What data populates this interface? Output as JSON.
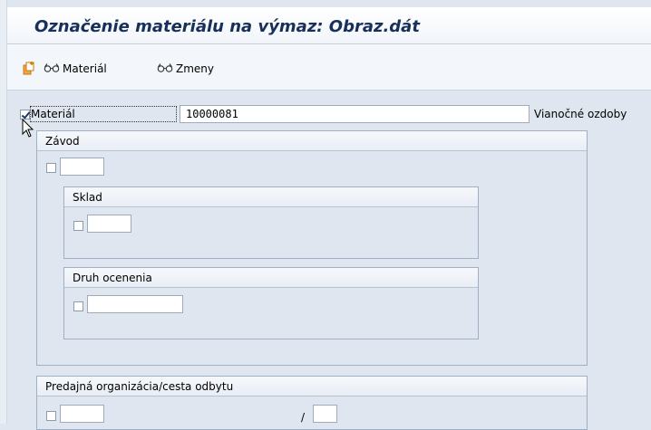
{
  "window": {
    "title": "Označenie materiálu na výmaz: Obraz.dát"
  },
  "toolbar": {
    "items": [
      {
        "icon": "new-document-icon",
        "label": ""
      },
      {
        "icon": "glasses-icon",
        "label": "Materiál"
      },
      {
        "icon": "glasses-icon",
        "label": "Zmeny"
      }
    ]
  },
  "material": {
    "checkbox_checked": true,
    "label": "Materiál",
    "value": "10000081",
    "description": "Vianočné ozdoby"
  },
  "plant_group": {
    "title": "Závod",
    "value": ""
  },
  "storage_group": {
    "title": "Sklad",
    "value": ""
  },
  "valuation_group": {
    "title": "Druh ocenenia",
    "value": ""
  },
  "sales_group": {
    "title": "Predajná organizácia/cesta odbytu",
    "sales_org": "",
    "separator": "/",
    "distribution_channel": ""
  },
  "colors": {
    "title_text": "#16305a",
    "background": "#dfe6ef",
    "group_border": "#9eb0c6"
  }
}
